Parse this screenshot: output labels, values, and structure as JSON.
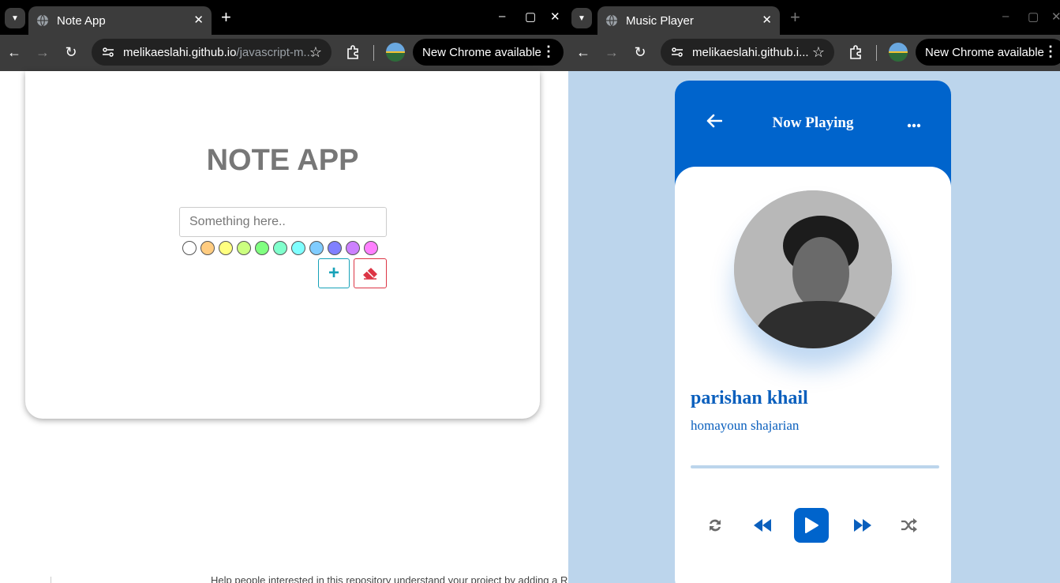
{
  "left_window": {
    "tab": {
      "title": "Note App",
      "close": "✕"
    },
    "new_tab": "+",
    "window_controls": {
      "minimize": "–",
      "maximize": "▢",
      "close": "✕"
    },
    "toolbar": {
      "url_host": "melikaeslahi.github.io",
      "url_path": "/javascript-m...",
      "update_label": "New Chrome available"
    },
    "note_app": {
      "title": "NOTE APP",
      "input_placeholder": "Something here..",
      "swatch_colors": [
        "#ffffff",
        "#ffcc80",
        "#ffff80",
        "#ccff80",
        "#80ff80",
        "#80ffcc",
        "#80ffff",
        "#80ccff",
        "#8080ff",
        "#cc80ff",
        "#ff80ff"
      ],
      "add_label": "+"
    },
    "page_text_below": "Help people interested in this repository understand your project by adding a Re"
  },
  "right_window": {
    "tab": {
      "title": "Music Player",
      "close": "✕"
    },
    "new_tab": "+",
    "window_controls": {
      "minimize": "–",
      "maximize": "▢",
      "close": "✕"
    },
    "toolbar": {
      "url_host": "melikaeslahi.github.i...",
      "update_label": "New Chrome available"
    },
    "player": {
      "header_title": "Now Playing",
      "song_title": "parishan khail",
      "artist": "homayoun shajarian",
      "progress": 0,
      "accent_color": "#0064cc",
      "controls": [
        "repeat-icon",
        "rewind-icon",
        "play-icon",
        "fast-forward-icon",
        "shuffle-icon"
      ]
    }
  }
}
